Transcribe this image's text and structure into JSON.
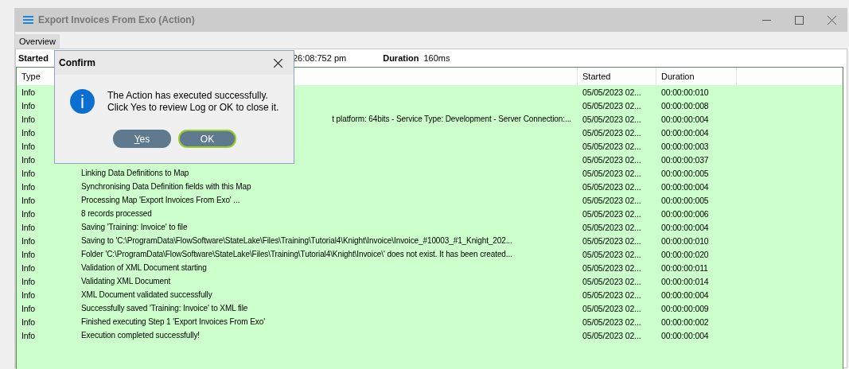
{
  "window": {
    "title": "Export Invoices From Exo (Action)"
  },
  "tabs": [
    {
      "label": "Overview",
      "selected": true
    }
  ],
  "summary": {
    "started_label": "Started",
    "started_value": "26:08:752 pm",
    "duration_label": "Duration",
    "duration_value": "160ms"
  },
  "log": {
    "columns": [
      "Type",
      "Started",
      "Duration"
    ],
    "rows": [
      {
        "type": "Info",
        "started": "05/05/2023 02...",
        "duration": "00:00:00:010"
      },
      {
        "type": "Info",
        "started": "05/05/2023 02...",
        "duration": "00:00:00:008"
      },
      {
        "type": "Info",
        "kind": "partial",
        "message": "t platform:  64bits - Service Type: Development - Server Connection:...",
        "started": "05/05/2023 02...",
        "duration": "00:00:00:004"
      },
      {
        "type": "Info",
        "started": "05/05/2023 02...",
        "duration": "00:00:00:004"
      },
      {
        "type": "Info",
        "started": "05/05/2023 02...",
        "duration": "00:00:00:003"
      },
      {
        "type": "Info",
        "started": "05/05/2023 02...",
        "duration": "00:00:00:037"
      },
      {
        "type": "Info",
        "kind": "full",
        "message": "Linking Data Definitions to Map",
        "started": "05/05/2023 02...",
        "duration": "00:00:00:005"
      },
      {
        "type": "Info",
        "message": "Synchronising Data Definition fields with this Map",
        "started": "05/05/2023 02...",
        "duration": "00:00:00:004"
      },
      {
        "type": "Info",
        "message": "Processing Map 'Export Invoices From Exo' ...",
        "started": "05/05/2023 02...",
        "duration": "00:00:00:005"
      },
      {
        "type": "Info",
        "message": "8 records processed",
        "started": "05/05/2023 02...",
        "duration": "00:00:00:006"
      },
      {
        "type": "Info",
        "message": "Saving 'Training: Invoice' to file",
        "started": "05/05/2023 02...",
        "duration": "00:00:00:004"
      },
      {
        "type": "Info",
        "message": "Saving to 'C:\\ProgramData\\FlowSoftware\\StateLake\\Files\\Training\\Tutorial4\\Knight\\Invoice\\Invoice_#10003_#1_Knight_202...",
        "started": "05/05/2023 02...",
        "duration": "00:00:00:010"
      },
      {
        "type": "Info",
        "message": "Folder 'C:\\ProgramData\\FlowSoftware\\StateLake\\Files\\Training\\Tutorial4\\Knight\\Invoice\\' does not exist.  It has been created...",
        "started": "05/05/2023 02...",
        "duration": "00:00:00:020"
      },
      {
        "type": "Info",
        "message": "Validation of XML Document starting",
        "started": "05/05/2023 02...",
        "duration": "00:00:00:011"
      },
      {
        "type": "Info",
        "message": "Validating XML Document",
        "started": "05/05/2023 02...",
        "duration": "00:00:00:014"
      },
      {
        "type": "Info",
        "message": "XML Document validated successfully",
        "started": "05/05/2023 02...",
        "duration": "00:00:00:004"
      },
      {
        "type": "Info",
        "message": "Successfully saved 'Training: Invoice' to XML file",
        "started": "05/05/2023 02...",
        "duration": "00:00:00:009"
      },
      {
        "type": "Info",
        "message": "Finished executing Step 1 'Export Invoices From Exo'",
        "started": "05/05/2023 02...",
        "duration": "00:00:00:002"
      },
      {
        "type": "Info",
        "message": "Execution completed successfully!",
        "started": "05/05/2023 02...",
        "duration": "00:00:00:004"
      }
    ]
  },
  "dialog": {
    "title": "Confirm",
    "message_lines": [
      "The Action has executed successfully.",
      "Click Yes to review Log or OK to close it."
    ],
    "buttons": [
      {
        "label": "Yes",
        "mnemonic": true,
        "selected": false
      },
      {
        "label": "OK",
        "mnemonic": false,
        "selected": true
      }
    ]
  }
}
